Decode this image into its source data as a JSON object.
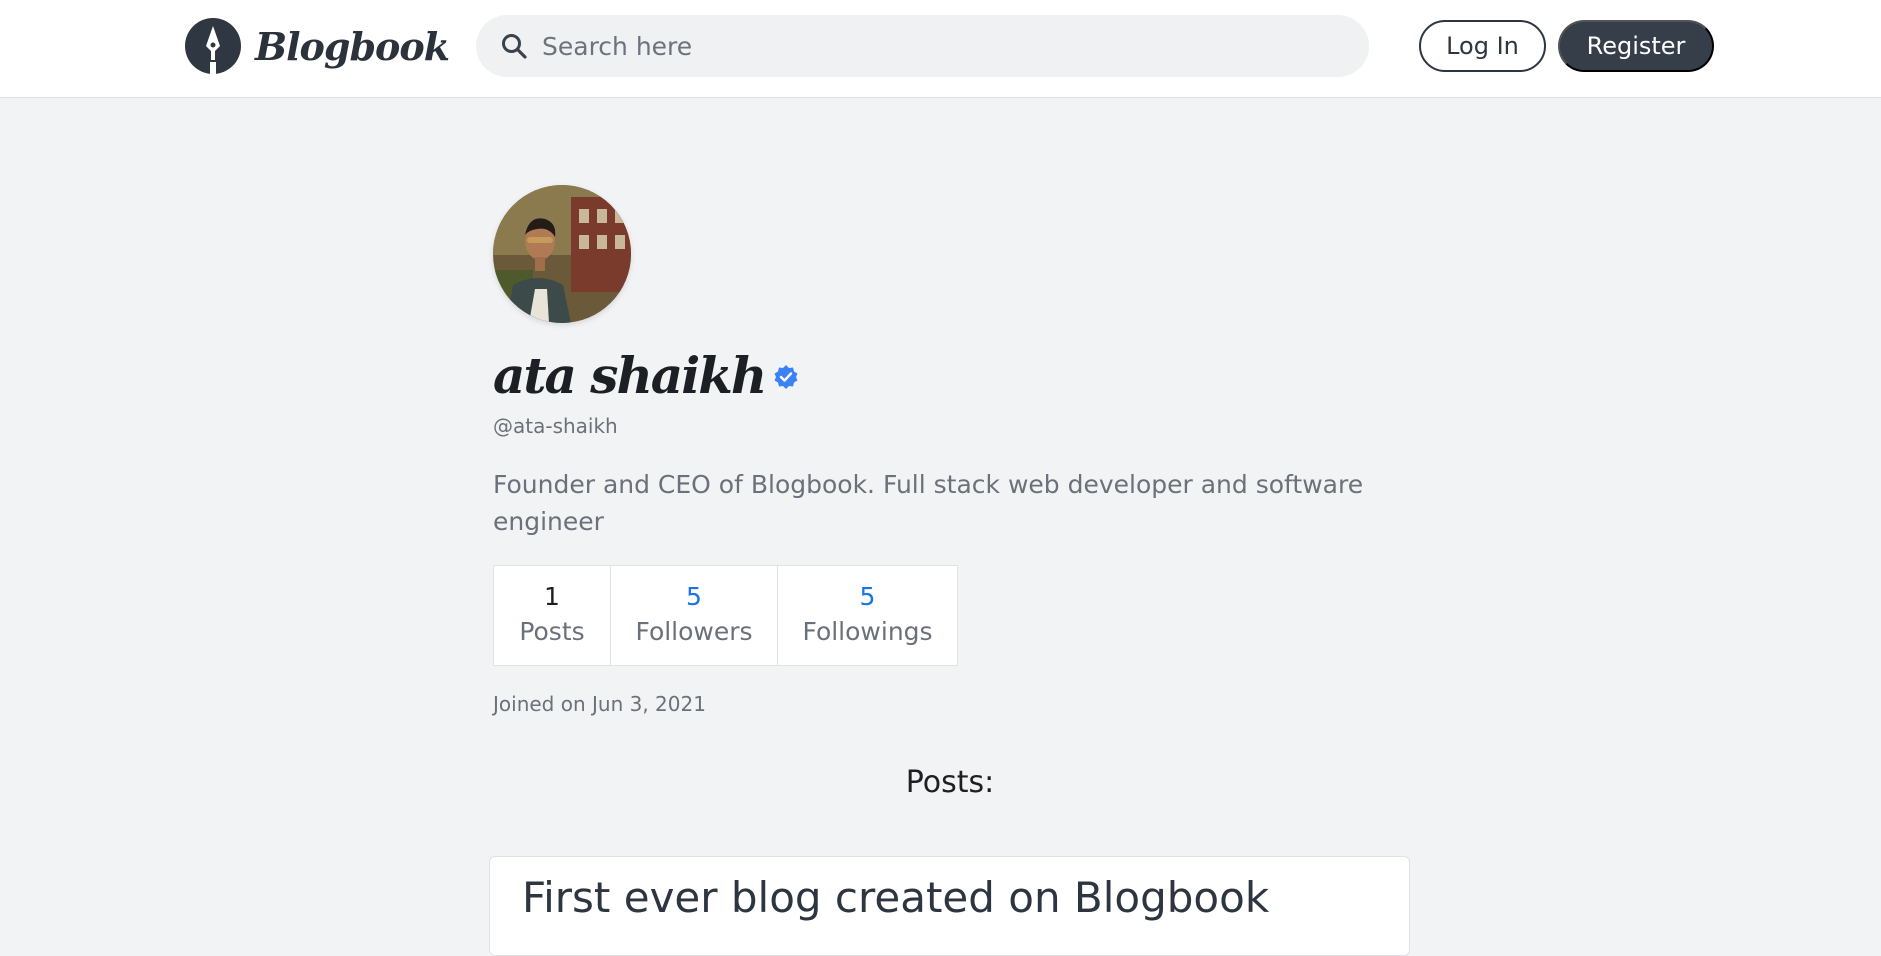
{
  "header": {
    "brand_name": "Blogbook",
    "search": {
      "placeholder": "Search here",
      "value": ""
    },
    "login_label": "Log In",
    "register_label": "Register"
  },
  "profile": {
    "name": "ata shaikh",
    "verified": true,
    "username": "@ata-shaikh",
    "bio": "Founder and CEO of Blogbook. Full stack web developer and software engineer",
    "stats": {
      "posts": {
        "value": "1",
        "label": "Posts"
      },
      "followers": {
        "value": "5",
        "label": "Followers"
      },
      "followings": {
        "value": "5",
        "label": "Followings"
      }
    },
    "joined": "Joined on Jun 3, 2021"
  },
  "posts_section": {
    "heading": "Posts:",
    "items": [
      {
        "title": "First ever blog created on Blogbook"
      }
    ]
  },
  "colors": {
    "page_background": "#f2f3f5",
    "header_background": "#ffffff",
    "primary_dark": "#363e4a",
    "link_blue": "#1a73e8",
    "verified_blue": "#3b82f6",
    "muted_text": "#6b717a"
  },
  "icons": {
    "logo": "pen-nib-icon",
    "search": "search-icon",
    "verified": "verified-badge-icon"
  }
}
